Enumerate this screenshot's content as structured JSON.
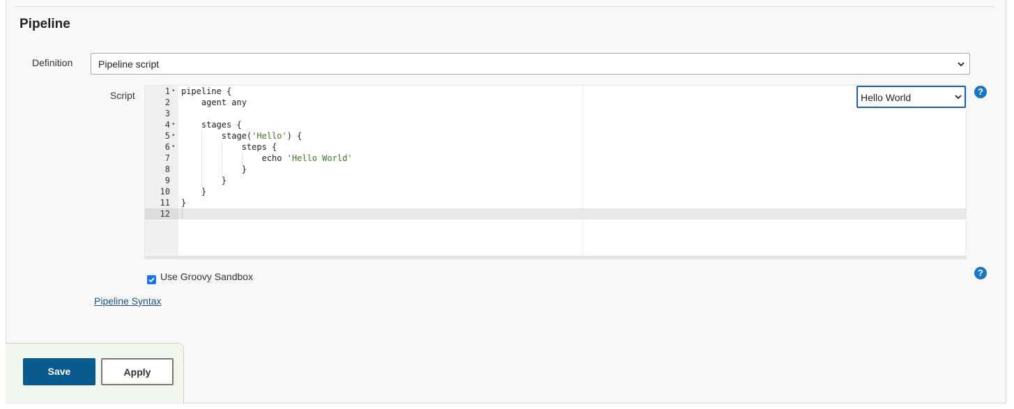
{
  "section": {
    "title": "Pipeline"
  },
  "definition": {
    "label": "Definition",
    "selected": "Pipeline script"
  },
  "script": {
    "label": "Script",
    "sample_selected": "Hello World",
    "lines": [
      {
        "n": "1",
        "text": "pipeline {",
        "fold": true
      },
      {
        "n": "2",
        "text": "    agent any",
        "fold": false
      },
      {
        "n": "3",
        "text": "",
        "fold": false
      },
      {
        "n": "4",
        "text": "    stages {",
        "fold": true
      },
      {
        "n": "5",
        "pre": "        stage(",
        "str": "'Hello'",
        "post": ") {",
        "fold": true
      },
      {
        "n": "6",
        "text": "            steps {",
        "fold": true
      },
      {
        "n": "7",
        "pre": "                echo ",
        "str": "'Hello World'",
        "post": "",
        "fold": false
      },
      {
        "n": "8",
        "text": "            }",
        "fold": false
      },
      {
        "n": "9",
        "text": "        }",
        "fold": false
      },
      {
        "n": "10",
        "text": "    }",
        "fold": false
      },
      {
        "n": "11",
        "text": "}",
        "fold": false
      },
      {
        "n": "12",
        "text": "",
        "fold": false
      }
    ],
    "active_line": "12"
  },
  "sandbox": {
    "label": "Use Groovy Sandbox",
    "checked": true
  },
  "links": {
    "pipeline_syntax": "Pipeline Syntax"
  },
  "help": {
    "glyph": "?"
  },
  "buttons": {
    "save": "Save",
    "apply": "Apply"
  },
  "colors": {
    "accent": "#0b5a8f",
    "help": "#1976c2",
    "string": "#3a7a1f",
    "footer_bg": "#f1f6ee"
  }
}
